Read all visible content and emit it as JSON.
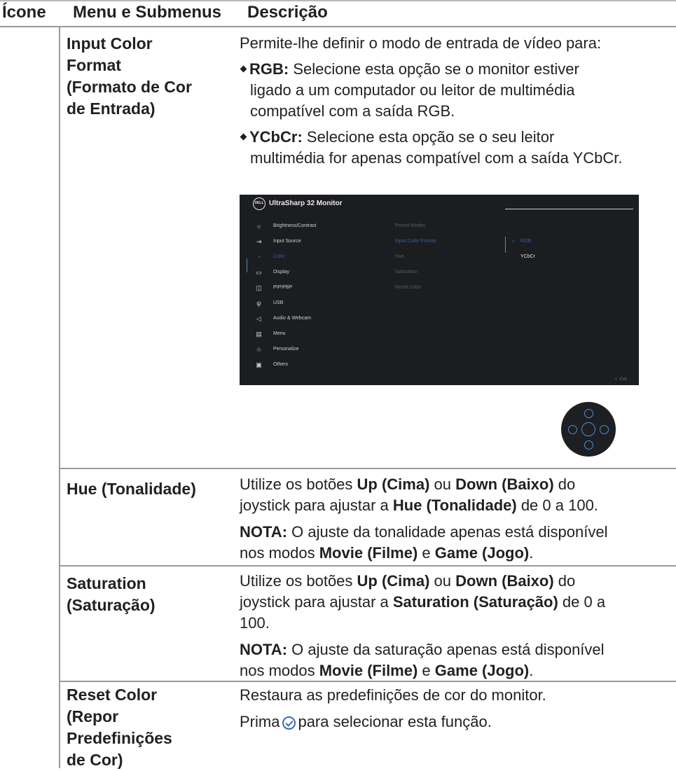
{
  "header": {
    "col_icon": "Ícone",
    "col_menu": "Menu e Submenus",
    "col_desc": "Descrição"
  },
  "rows": {
    "input_color_format": {
      "menu_lines": [
        "Input Color",
        "Format",
        "(Formato de Cor",
        "de Entrada)"
      ],
      "intro": "Permite-lhe definir o modo de entrada de vídeo para:",
      "rgb_label": "RGB:",
      "rgb_lines": [
        " Selecione esta opção se o monitor estiver",
        "ligado a um computador ou leitor de multimédia",
        "compatível com a saída RGB."
      ],
      "ycbcr_label": "YCbCr:",
      "ycbcr_lines": [
        " Selecione esta opção se o seu leitor",
        "multimédia for apenas compatível com a saída YCbCr."
      ]
    },
    "hue": {
      "menu": "Hue (Tonalidade)",
      "l1a": "Utilize os botões ",
      "l1b": "Up (Cima)",
      "l1c": " ou ",
      "l1d": "Down (Baixo)",
      "l1e": " do",
      "l2a": "joystick para ajustar a ",
      "l2b": "Hue (Tonalidade)",
      "l2c": " de 0 a 100.",
      "n1a": "NOTA:",
      "n1b": " O ajuste da tonalidade apenas está disponível",
      "n2a": "nos modos ",
      "n2b": "Movie (Filme)",
      "n2c": " e ",
      "n2d": "Game (Jogo)",
      "n2e": "."
    },
    "saturation": {
      "menu_lines": [
        "Saturation",
        "(Saturação)"
      ],
      "l1a": "Utilize os botões ",
      "l1b": "Up (Cima)",
      "l1c": " ou ",
      "l1d": "Down (Baixo)",
      "l1e": " do",
      "l2a": "joystick para ajustar a ",
      "l2b": "Saturation (Saturação)",
      "l2c": " de 0 a",
      "l3": "100.",
      "n1a": "NOTA:",
      "n1b": " O ajuste da saturação apenas está disponível",
      "n2a": "nos modos ",
      "n2b": "Movie (Filme)",
      "n2c": " e ",
      "n2d": "Game (Jogo)",
      "n2e": "."
    },
    "reset_color": {
      "menu_lines": [
        "Reset Color",
        "(Repor",
        "Predefinições",
        "de Cor)"
      ],
      "l1": "Restaura as predefinições de cor do monitor.",
      "l2a": "Prima",
      "l2b": "para selecionar esta função."
    }
  },
  "osd": {
    "logo": "DELL",
    "title": "UltraSharp 32 Monitor",
    "menu_items": [
      "Brightness/Contrast",
      "Input Source",
      "Color",
      "Display",
      "PIP/PBP",
      "USB",
      "Audio & Webcam",
      "Menu",
      "Personalize",
      "Others"
    ],
    "sub_items": [
      "Preset Modes",
      "Input Color Format",
      "Hue",
      "Saturation",
      "Reset Color"
    ],
    "options": [
      "RGB",
      "YCbCr"
    ],
    "exit": "Exit"
  }
}
